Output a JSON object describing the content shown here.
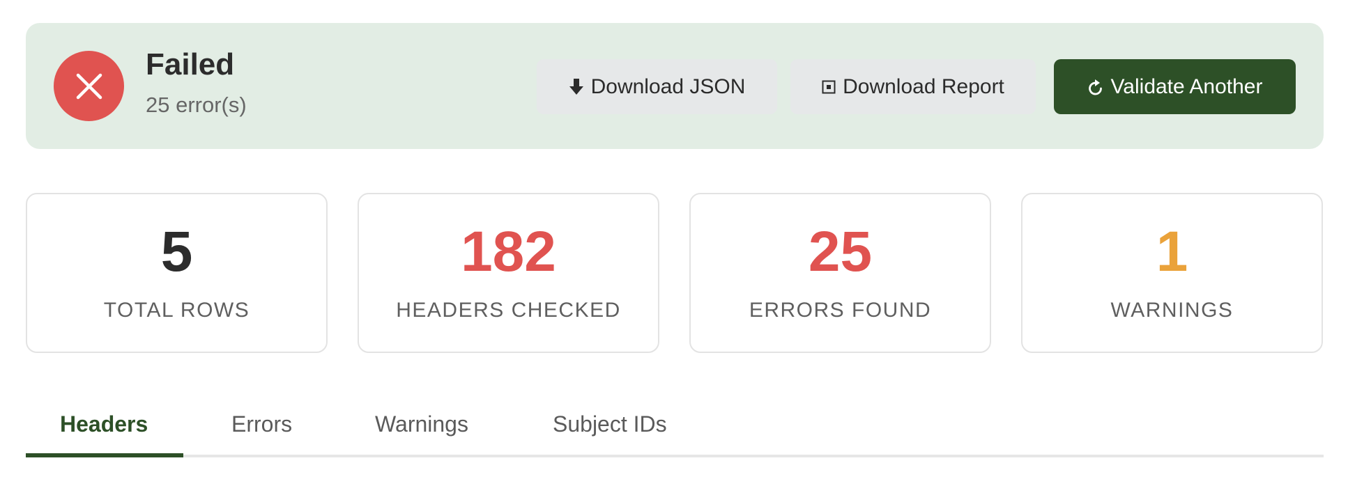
{
  "status": {
    "title": "Failed",
    "subtitle": "25 error(s)",
    "icon": "close-icon",
    "color": "#e05350"
  },
  "actions": {
    "download_json": {
      "label": "Download JSON",
      "icon": "download-arrow-icon"
    },
    "download_report": {
      "label": "Download Report",
      "icon": "report-square-icon"
    },
    "validate_another": {
      "label": "Validate Another",
      "icon": "refresh-icon"
    }
  },
  "stats": [
    {
      "value": "5",
      "label": "TOTAL ROWS",
      "color": "#2c2c2c"
    },
    {
      "value": "182",
      "label": "HEADERS CHECKED",
      "color": "#e05350"
    },
    {
      "value": "25",
      "label": "ERRORS FOUND",
      "color": "#e05350"
    },
    {
      "value": "1",
      "label": "WARNINGS",
      "color": "#eaa23a"
    }
  ],
  "tabs": [
    {
      "label": "Headers",
      "active": true
    },
    {
      "label": "Errors",
      "active": false
    },
    {
      "label": "Warnings",
      "active": false
    },
    {
      "label": "Subject IDs",
      "active": false
    }
  ],
  "theme": {
    "banner_bg": "#e2ede4",
    "primary": "#2d5027",
    "error": "#e05350",
    "warning": "#eaa23a"
  }
}
